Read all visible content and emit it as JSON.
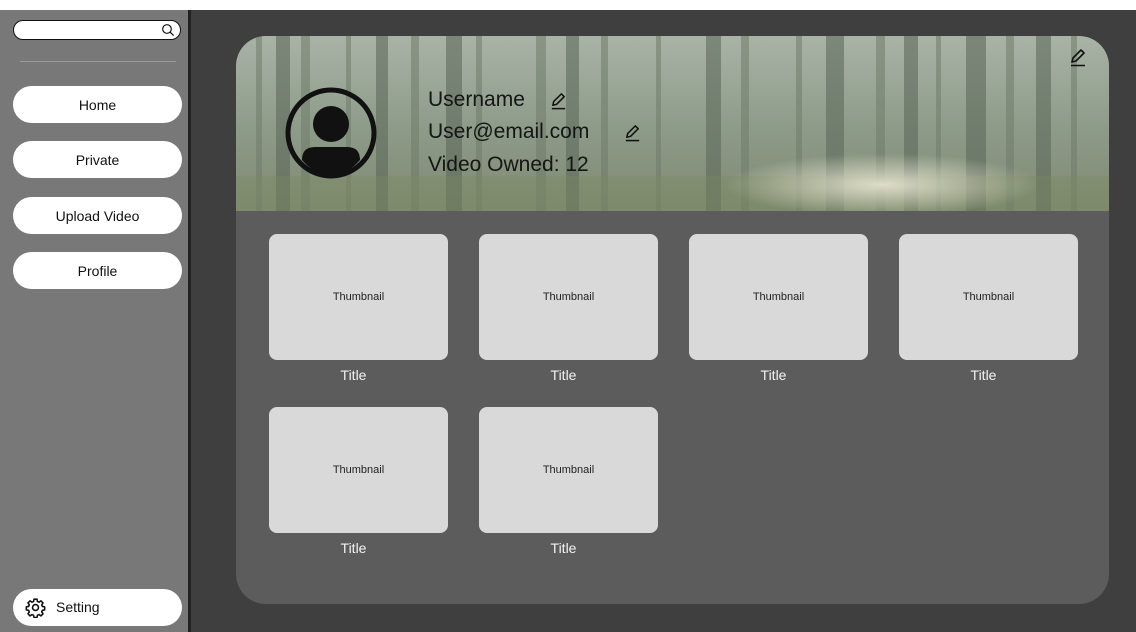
{
  "search": {
    "placeholder": "",
    "value": ""
  },
  "sidebar": {
    "items": [
      {
        "label": "Home"
      },
      {
        "label": "Private"
      },
      {
        "label": "Upload Video"
      },
      {
        "label": "Profile"
      }
    ],
    "setting_label": "Setting"
  },
  "profile": {
    "username": "Username",
    "email": "User@email.com",
    "video_count": "Video Owned: 12"
  },
  "videos": [
    {
      "thumbnail": "Thumbnail",
      "title": "Title"
    },
    {
      "thumbnail": "Thumbnail",
      "title": "Title"
    },
    {
      "thumbnail": "Thumbnail",
      "title": "Title"
    },
    {
      "thumbnail": "Thumbnail",
      "title": "Title"
    },
    {
      "thumbnail": "Thumbnail",
      "title": "Title"
    },
    {
      "thumbnail": "Thumbnail",
      "title": "Title"
    }
  ],
  "colors": {
    "sidebar": "#787878",
    "background": "#3f3f3f",
    "card": "#5c5c5c",
    "thumbnail": "#d9d9d9"
  },
  "icons": {
    "search": "search-icon",
    "setting": "gear-icon",
    "edit": "pencil-icon",
    "avatar": "user-avatar-icon"
  }
}
